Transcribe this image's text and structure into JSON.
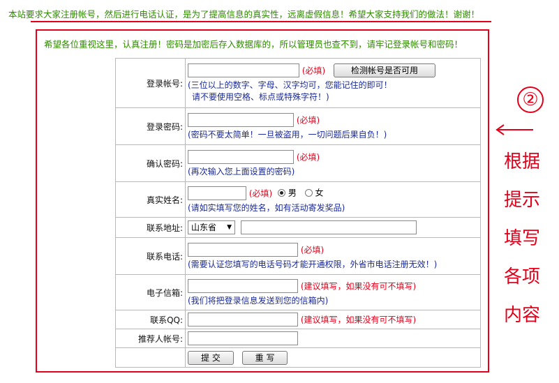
{
  "notices": {
    "top": "本站要求大家注册帐号，然后进行电话认证，是为了提高信息的真实性，远离虚假信息！希望大家支持我们的做法！谢谢！",
    "sub": "希望各位重视这里，认真注册！密码是加密后存入数据库的，所以管理员也查不到，请牢记登录帐号和密码！"
  },
  "form": {
    "account": {
      "label": "登录帐号:",
      "required": "(必填)",
      "check_button": "检测帐号是否可用",
      "hint1": "(三位以上的数字、字母、汉字均可，您能记住的即可！",
      "hint2": "请不要使用空格、标点或特殊字符！)"
    },
    "password": {
      "label": "登录密码:",
      "required": "(必填)",
      "hint": "(密码不要太简单！一旦被盗用，一切问题后果自负！)"
    },
    "confirm": {
      "label": "确认密码:",
      "required": "(必填)",
      "hint": "(再次输入您上面设置的密码)"
    },
    "realname": {
      "label": "真实姓名:",
      "required": "(必填)",
      "gender_male": "男",
      "gender_female": "女",
      "selected_gender": "男",
      "hint": "(请如实填写您的姓名，如有活动寄发奖品)"
    },
    "address": {
      "label": "联系地址:",
      "province_selected": "山东省"
    },
    "phone": {
      "label": "联系电话:",
      "required": "(必填)",
      "hint": "(需要认证您填写的电话号码才能开通权限，外省市电话注册无效！)"
    },
    "email": {
      "label": "电子信箱:",
      "suggest": "(建议填写，如果没有可不填写)",
      "hint": "(我们将把登录信息发送到您的信箱内)"
    },
    "qq": {
      "label": "联系QQ:",
      "suggest": "(建议填写，如果没有可不填写)"
    },
    "referrer": {
      "label": "推荐人帐号:"
    },
    "buttons": {
      "submit": "提 交",
      "reset": "重 写"
    }
  },
  "annotation": {
    "number": "②",
    "lines": [
      "根据",
      "提示",
      "填写",
      "各项",
      "内容"
    ],
    "color": "#e2001a"
  }
}
